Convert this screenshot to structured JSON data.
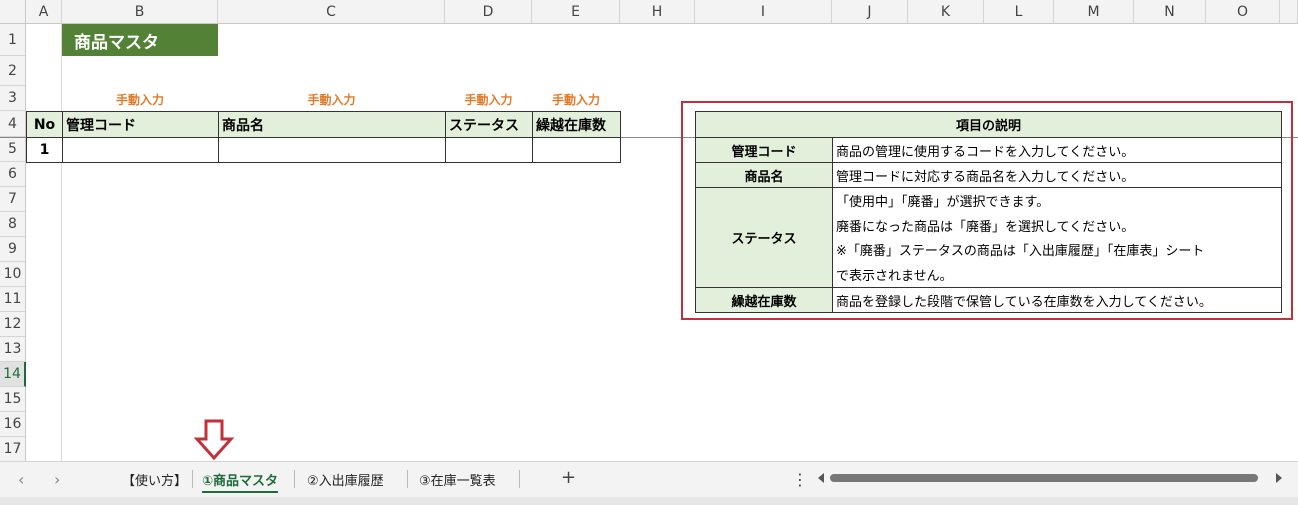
{
  "columns": [
    "A",
    "B",
    "C",
    "D",
    "E",
    "H",
    "I",
    "J",
    "K",
    "L",
    "M",
    "N",
    "O"
  ],
  "rows": [
    "1",
    "2",
    "3",
    "4",
    "5",
    "6",
    "7",
    "8",
    "9",
    "10",
    "11",
    "12",
    "13",
    "14",
    "15",
    "16",
    "17"
  ],
  "active_row": "14",
  "sheet": {
    "title": "商品マスタ",
    "manual_label": "手動入力",
    "headers": {
      "no": "No",
      "code": "管理コード",
      "name": "商品名",
      "status": "ステータス",
      "stock": "繰越在庫数"
    },
    "first_row_no": "1"
  },
  "description": {
    "header": "項目の説明",
    "items": [
      {
        "label": "管理コード",
        "text": "商品の管理に使用するコードを入力してください。"
      },
      {
        "label": "商品名",
        "text": "管理コードに対応する商品名を入力してください。"
      },
      {
        "label": "ステータス",
        "lines": [
          "「使用中」「廃番」が選択できます。",
          "廃番になった商品は「廃番」を選択してください。",
          "※「廃番」ステータスの商品は「入出庫履歴」「在庫表」シート",
          "で表示されません。"
        ]
      },
      {
        "label": "繰越在庫数",
        "text": "商品を登録した段階で保管している在庫数を入力してください。"
      }
    ]
  },
  "tabs": {
    "prev": "‹",
    "next": "›",
    "items": [
      "【使い方】",
      "①商品マスタ",
      "②入出庫履歴",
      "③在庫一覧表"
    ],
    "active_index": 1,
    "add": "+",
    "more": "⋮"
  },
  "colors": {
    "accent_green": "#538135",
    "header_fill": "#e2efda",
    "highlight_red": "#c0313a",
    "manual_orange": "#e07b2a"
  }
}
